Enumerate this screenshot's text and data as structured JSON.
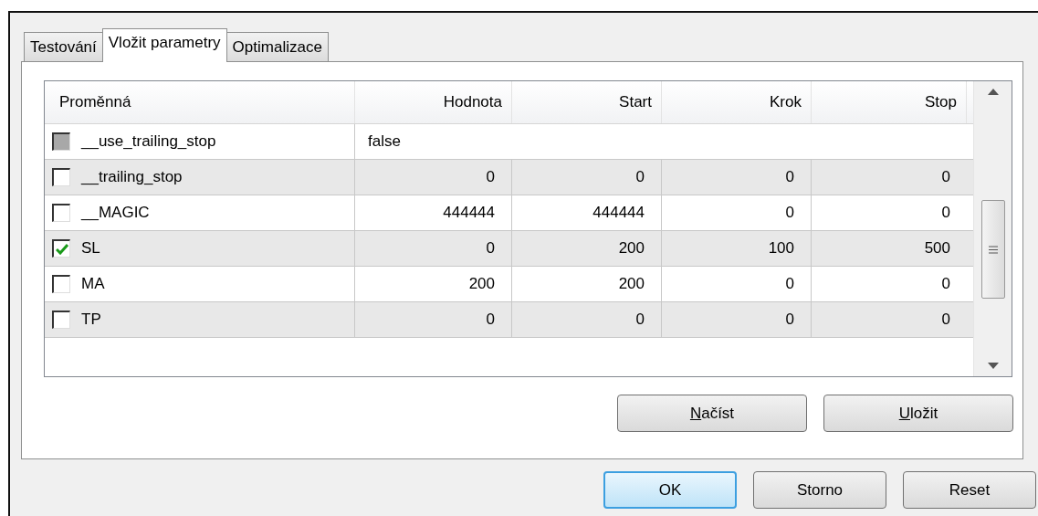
{
  "tabs": [
    {
      "label": "Testování",
      "selected": false
    },
    {
      "label": "Vložit parametry",
      "selected": true
    },
    {
      "label": "Optimalizace",
      "selected": false
    }
  ],
  "table": {
    "columns": [
      "Proměnná",
      "Hodnota",
      "Start",
      "Krok",
      "Stop"
    ],
    "rows": [
      {
        "kind": "bool",
        "checked": false,
        "disabled": true,
        "name": "__use_trailing_stop",
        "value": "false"
      },
      {
        "kind": "number",
        "checked": false,
        "disabled": false,
        "name": "__trailing_stop",
        "value": "0",
        "start": "0",
        "step": "0",
        "stop": "0"
      },
      {
        "kind": "number",
        "checked": false,
        "disabled": false,
        "name": "__MAGIC",
        "value": "444444",
        "start": "444444",
        "step": "0",
        "stop": "0"
      },
      {
        "kind": "number",
        "checked": true,
        "disabled": false,
        "name": "SL",
        "value": "0",
        "start": "200",
        "step": "100",
        "stop": "500"
      },
      {
        "kind": "number",
        "checked": false,
        "disabled": false,
        "name": "MA",
        "value": "200",
        "start": "200",
        "step": "0",
        "stop": "0"
      },
      {
        "kind": "number",
        "checked": false,
        "disabled": false,
        "name": "TP",
        "value": "0",
        "start": "0",
        "step": "0",
        "stop": "0"
      }
    ]
  },
  "panel_buttons": [
    {
      "label": "Načíst",
      "access_key_first": true
    },
    {
      "label": "Uložit",
      "access_key_first": true
    }
  ],
  "dialog_buttons": [
    {
      "label": "OK",
      "default": true
    },
    {
      "label": "Storno",
      "default": false
    },
    {
      "label": "Reset",
      "default": false
    }
  ]
}
